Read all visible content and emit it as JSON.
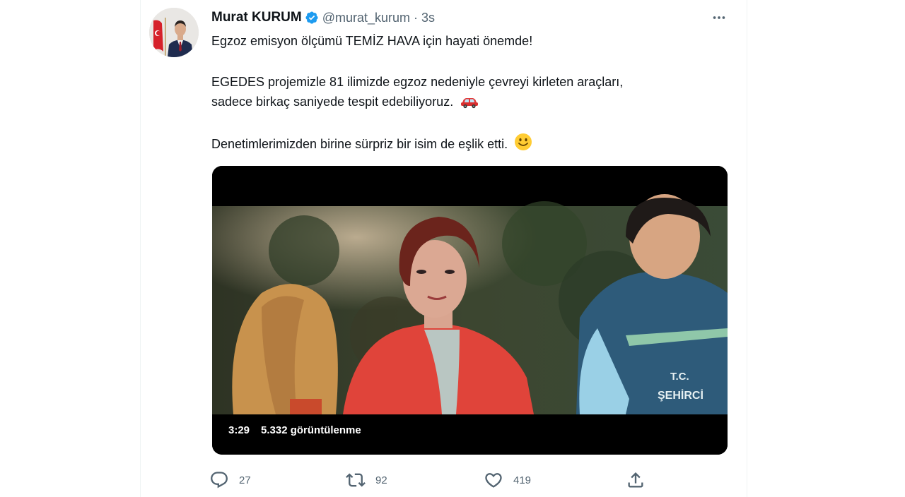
{
  "tweet": {
    "author": {
      "display_name": "Murat KURUM",
      "handle": "@murat_kurum",
      "verified_icon": "verified-badge-icon"
    },
    "separator": "·",
    "timestamp": "3s",
    "more_icon": "more-horizontal-icon",
    "text": {
      "line1": "Egzoz emisyon ölçümü TEMİZ HAVA için hayati önemde!",
      "line2": "EGEDES projemizle 81 ilimizde egzoz nedeniyle çevreyi kirleten araçları,",
      "line3": "sadece birkaç saniyede tespit edebiliyoruz.",
      "line3_emoji": "car-emoji",
      "line4": "Denetimlerimizden birine sürpriz bir isim de eşlik etti.",
      "line4_emoji": "smiling-face-emoji"
    },
    "video": {
      "duration": "3:29",
      "views": "5.332 görüntülenme"
    },
    "actions": {
      "reply_count": "27",
      "retweet_count": "92",
      "like_count": "419"
    }
  },
  "colors": {
    "text_primary": "#0f1419",
    "text_secondary": "#536471",
    "verified_blue": "#1d9bf0",
    "border": "#eff3f4"
  }
}
